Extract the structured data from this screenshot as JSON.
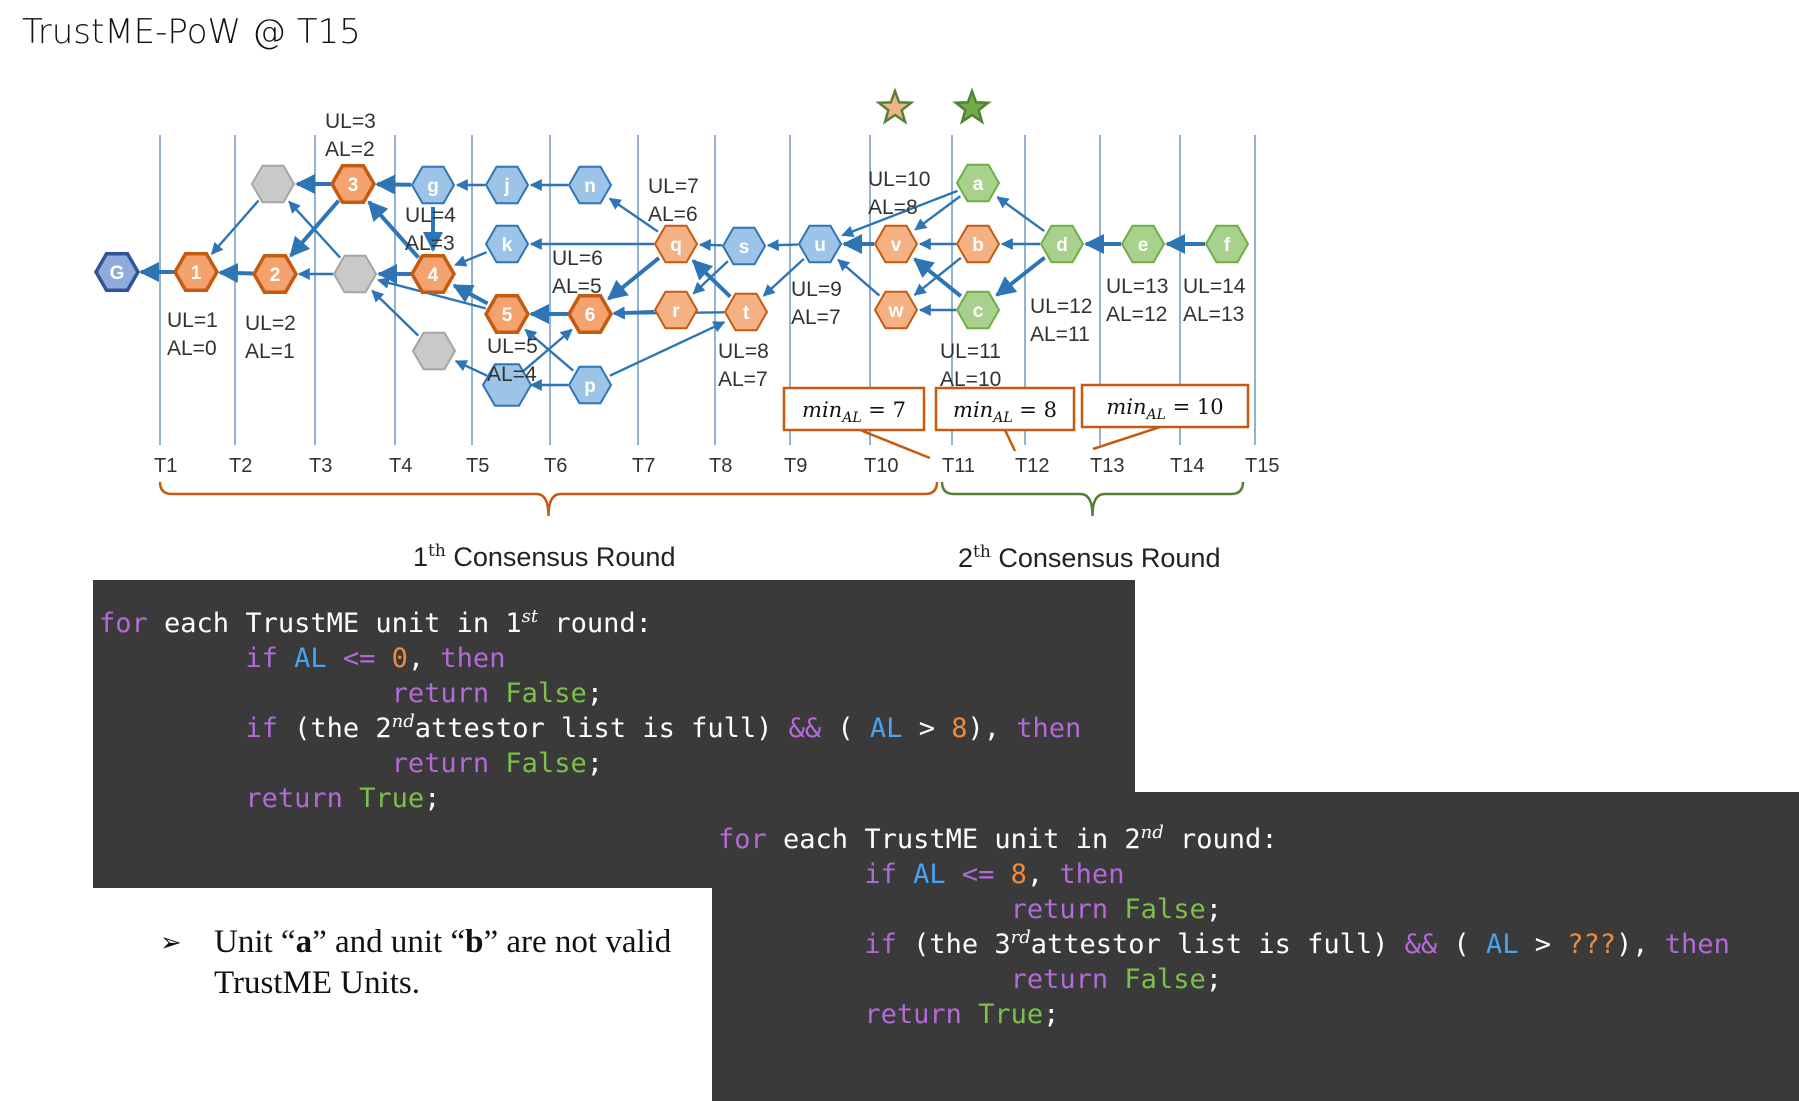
{
  "title": "TrustME-PoW @ T15",
  "timeline": [
    "T1",
    "T2",
    "T3",
    "T4",
    "T5",
    "T6",
    "T7",
    "T8",
    "T9",
    "T10",
    "T11",
    "T12",
    "T13",
    "T14",
    "T15"
  ],
  "nodes": [
    {
      "id": "G",
      "label": "G",
      "color": "blue_dark"
    },
    {
      "id": "1",
      "label": "1",
      "color": "orange"
    },
    {
      "id": "2",
      "label": "2",
      "color": "orange"
    },
    {
      "id": "3",
      "label": "3",
      "color": "orange"
    },
    {
      "id": "4",
      "label": "4",
      "color": "orange"
    },
    {
      "id": "5",
      "label": "5",
      "color": "orange"
    },
    {
      "id": "6",
      "label": "6",
      "color": "orange"
    },
    {
      "id": "gr1",
      "label": "",
      "color": "gray"
    },
    {
      "id": "gr2",
      "label": "",
      "color": "gray"
    },
    {
      "id": "gr3",
      "label": "",
      "color": "gray"
    },
    {
      "id": "g",
      "label": "g",
      "color": "blue"
    },
    {
      "id": "j",
      "label": "j",
      "color": "blue"
    },
    {
      "id": "n",
      "label": "n",
      "color": "blue"
    },
    {
      "id": "k",
      "label": "k",
      "color": "blue"
    },
    {
      "id": "h",
      "label": "",
      "color": "blue"
    },
    {
      "id": "p",
      "label": "p",
      "color": "blue"
    },
    {
      "id": "q",
      "label": "q",
      "color": "orange_light"
    },
    {
      "id": "r",
      "label": "r",
      "color": "orange_light"
    },
    {
      "id": "s",
      "label": "s",
      "color": "blue"
    },
    {
      "id": "t",
      "label": "t",
      "color": "orange_light"
    },
    {
      "id": "u",
      "label": "u",
      "color": "blue"
    },
    {
      "id": "v",
      "label": "v",
      "color": "orange_light"
    },
    {
      "id": "w",
      "label": "w",
      "color": "orange_light"
    },
    {
      "id": "a",
      "label": "a",
      "color": "green"
    },
    {
      "id": "b",
      "label": "b",
      "color": "orange_light"
    },
    {
      "id": "c",
      "label": "c",
      "color": "green"
    },
    {
      "id": "d",
      "label": "d",
      "color": "green"
    },
    {
      "id": "e",
      "label": "e",
      "color": "green"
    },
    {
      "id": "f",
      "label": "f",
      "color": "green"
    }
  ],
  "edges": [
    [
      "1",
      "G",
      1
    ],
    [
      "2",
      "1",
      1
    ],
    [
      "gr1",
      "1",
      0
    ],
    [
      "3",
      "2",
      1
    ],
    [
      "3",
      "gr1",
      1
    ],
    [
      "gr2",
      "2",
      0
    ],
    [
      "4",
      "gr2",
      1
    ],
    [
      "4",
      "3",
      1
    ],
    [
      "gr2",
      "gr1",
      0
    ],
    [
      "g",
      "3",
      1
    ],
    [
      "g",
      "4",
      1
    ],
    [
      "j",
      "g",
      0
    ],
    [
      "n",
      "j",
      0
    ],
    [
      "k",
      "4",
      0
    ],
    [
      "5",
      "4",
      1
    ],
    [
      "5",
      "gr2",
      0
    ],
    [
      "6",
      "5",
      1
    ],
    [
      "gr3",
      "gr2",
      0
    ],
    [
      "h",
      "gr3",
      0
    ],
    [
      "p",
      "h",
      0
    ],
    [
      "h",
      "6",
      0
    ],
    [
      "p",
      "5",
      0
    ],
    [
      "q",
      "k",
      0
    ],
    [
      "q",
      "6",
      1
    ],
    [
      "q",
      "n",
      0
    ],
    [
      "s",
      "q",
      0
    ],
    [
      "s",
      "r",
      0
    ],
    [
      "r",
      "6",
      0
    ],
    [
      "t",
      "6",
      0
    ],
    [
      "t",
      "q",
      1
    ],
    [
      "u",
      "s",
      0
    ],
    [
      "u",
      "t",
      0
    ],
    [
      "p",
      "t",
      0
    ],
    [
      "v",
      "u",
      1
    ],
    [
      "w",
      "u",
      0
    ],
    [
      "a",
      "u",
      0
    ],
    [
      "a",
      "v",
      0
    ],
    [
      "b",
      "v",
      0
    ],
    [
      "b",
      "w",
      0
    ],
    [
      "c",
      "v",
      1
    ],
    [
      "c",
      "w",
      0
    ],
    [
      "d",
      "a",
      0
    ],
    [
      "d",
      "b",
      0
    ],
    [
      "d",
      "c",
      1
    ],
    [
      "e",
      "d",
      1
    ],
    [
      "f",
      "e",
      1
    ]
  ],
  "annotations": [
    "UL=3\nAL=2",
    "UL=4\nAL=3",
    "UL=1\nAL=0",
    "UL=2\nAL=1",
    "UL=6\nAL=5",
    "UL=5\nAL=4",
    "UL=7\nAL=6",
    "UL=8\nAL=7",
    "UL=9\nAL=7",
    "UL=10\nAL=8",
    "UL=11\nAL=10",
    "UL=12\nAL=11",
    "UL=13\nAL=12",
    "UL=14\nAL=13"
  ],
  "min_boxes": [
    {
      "label": "min",
      "sub": "AL",
      "value": "= 7"
    },
    {
      "label": "min",
      "sub": "AL",
      "value": "= 8"
    },
    {
      "label": "min",
      "sub": "AL",
      "value": "= 10"
    }
  ],
  "rounds": [
    {
      "num": "1",
      "sup": "th",
      "text": " Consensus Round",
      "color": "#c55a11"
    },
    {
      "num": "2",
      "sup": "th",
      "text": " Consensus Round",
      "color": "#548235"
    }
  ],
  "colors": {
    "blue": "#9dc3e6",
    "blue_stroke": "#2e75b6",
    "blue_dark": "#8faadc",
    "blue_dark_stroke": "#2f5597",
    "orange": "#f4a26e",
    "orange_stroke": "#c55a11",
    "orange_light": "#f4b183",
    "green": "#a9d18e",
    "green_stroke": "#70ad47",
    "gray": "#c9c9c9",
    "gray_stroke": "#a5a5a5",
    "arrow": "#2e75b6",
    "gridline": "#4a7ebb",
    "box": "#c55a11"
  },
  "stars": [
    {
      "color": "orange",
      "over": "T10"
    },
    {
      "color": "green",
      "over": "T11"
    }
  ],
  "code1": {
    "kw_for": "for",
    "l1": " each TrustME unit in 1",
    "l1_sup": "st",
    "l1_end": " round:",
    "kw_if": "if",
    "var_al": "AL",
    "op_le": " <= ",
    "n0": "0",
    "comma_then": ", ",
    "kw_then": "then",
    "kw_return": "return",
    "false": "False",
    "semi": ";",
    "l4a": " (the 2",
    "l4_sup": "nd",
    "l4b": "attestor list is full) ",
    "and": "&&",
    "paren": " ( ",
    "gt": " > ",
    "n8": "8",
    "close": "), ",
    "true": "True"
  },
  "code2": {
    "kw_for": "for",
    "l1": " each TrustME unit in 2",
    "l1_sup": "nd",
    "l1_end": " round:",
    "kw_if": "if",
    "var_al": "AL",
    "op_le": " <= ",
    "n8": "8",
    "comma_then": ", ",
    "kw_then": "then",
    "kw_return": "return",
    "false": "False",
    "semi": ";",
    "l4a": " (the 3",
    "l4_sup": "rd",
    "l4b": "attestor list is full) ",
    "and": "&&",
    "paren": " ( ",
    "gt": " > ",
    "qqq": "???",
    "close": "), ",
    "true": "True"
  },
  "note": {
    "arrow": "➢",
    "t1": "Unit “",
    "a": "a",
    "t2": "” and unit “",
    "b": "b",
    "t3": "” are not valid TrustME Units."
  }
}
